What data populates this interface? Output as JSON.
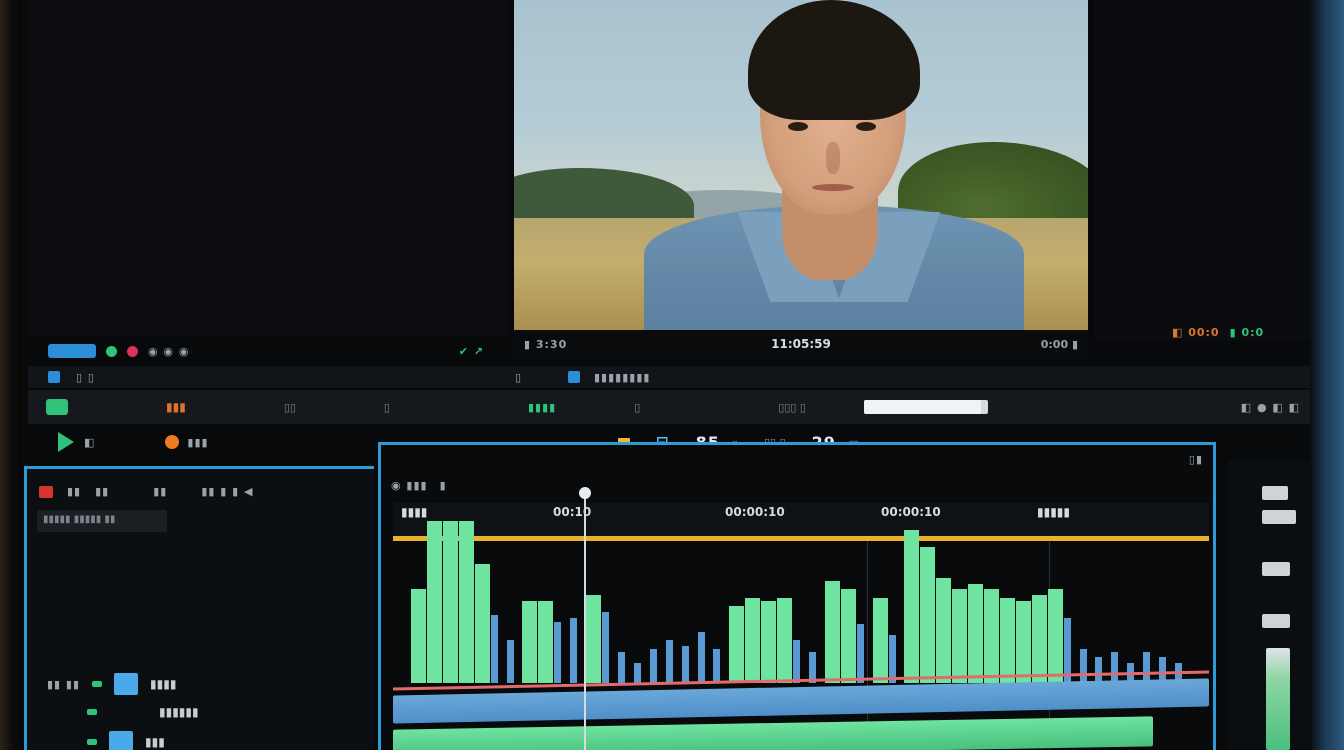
{
  "source_panel": {
    "bar_label": "◉ ◉ ◉",
    "right_icon": "✔ ↗"
  },
  "program_monitor": {
    "left_readout": "▮ 3:30",
    "timecode": "11:05:59",
    "right_readout": "0:00 ▮"
  },
  "right_panel": {
    "chip_a": "◧ 00:0",
    "chip_b": "▮ 0:0"
  },
  "scrub_bar": {
    "label_a": "▯ ▯",
    "label_b": "▯",
    "label_c": "▮▮▮▮▮▮▮▮"
  },
  "toolbar": {
    "orange_label": "▮▮▮",
    "slot_a": "▯▯",
    "slot_b": "▯",
    "green_readout": "▮▮▮▮",
    "slot_c": "▯",
    "slot_d": "▯▯▯ ▯",
    "progress": 0.94,
    "right_icons": "◧ ● ◧ ◧"
  },
  "tc_row": {
    "play_label": "◧",
    "orange_label": "▮▮▮",
    "tc_in_icon": "⊟",
    "tc_main": "85",
    "tc_main_sep": "· ▯",
    "tc_mid": "▯▯ ▯",
    "tc_out": "29",
    "tc_out_sep": "- ▣"
  },
  "tracks_panel": {
    "top_labels": [
      "▮▮",
      "▮▮",
      "▮▮",
      "▮▮ ▮ ▮ ◀"
    ],
    "search_text": "▮▮▮▮▮ ▮▮▮▮▮ ▮▮",
    "tracks": [
      {
        "name": "▮▮▮▮"
      },
      {
        "name": "▮▮▮▮▮▮"
      },
      {
        "name": "▮▮▮"
      }
    ]
  },
  "timeline": {
    "head_labels": [
      "◉ ▮▮▮",
      "▮"
    ],
    "ruler_labels": [
      {
        "text": "▮▮▮▮"
      },
      {
        "text": "00:10"
      },
      {
        "text": "00:00:10"
      },
      {
        "text": "00:00:10"
      },
      {
        "text": "▮▮▮▮▮"
      }
    ],
    "corner_label": "▯▮"
  },
  "audio_levels": [
    0.55,
    0.95,
    0.95,
    0.95,
    0.7,
    0.4,
    0.25,
    0.48,
    0.48,
    0.36,
    0.38,
    0.52,
    0.42,
    0.18,
    0.12,
    0.2,
    0.25,
    0.22,
    0.3,
    0.2,
    0.45,
    0.5,
    0.48,
    0.5,
    0.25,
    0.18,
    0.6,
    0.55,
    0.35,
    0.5,
    0.28,
    0.9,
    0.8,
    0.62,
    0.55,
    0.58,
    0.55,
    0.5,
    0.48,
    0.52,
    0.55,
    0.38,
    0.2,
    0.15,
    0.18,
    0.12,
    0.18,
    0.15,
    0.12
  ],
  "colors": {
    "accent_blue": "#2e9bd9",
    "clip_green": "#6fe3a0",
    "clip_blue": "#5a9ad2",
    "ruler_gold": "#e7b12a"
  }
}
